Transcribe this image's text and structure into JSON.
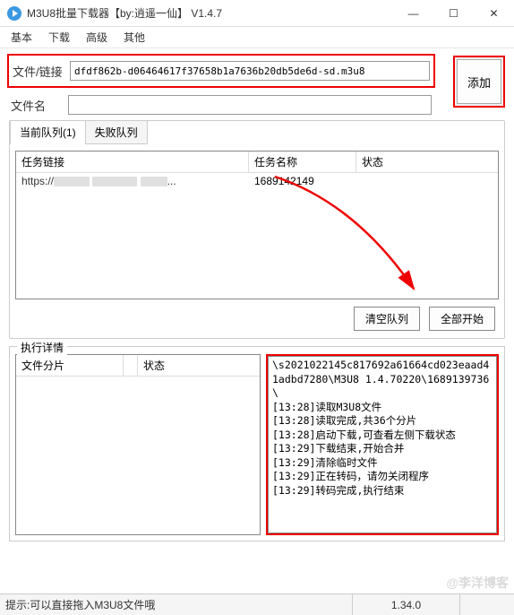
{
  "title": "M3U8批量下载器【by:逍遥一仙】   V1.4.7",
  "menu": [
    "基本",
    "下载",
    "高级",
    "其他"
  ],
  "file_link_label": "文件/链接",
  "file_link_value": "dfdf862b-d06464617f37658b1a7636b20db5de6d-sd.m3u8",
  "filename_label": "文件名",
  "add_button": "添加",
  "tabs": {
    "current": "当前队列(1)",
    "failed": "失败队列"
  },
  "queue_headers": {
    "link": "任务链接",
    "name": "任务名称",
    "status": "状态"
  },
  "queue_row": {
    "link_prefix": "https://",
    "link_suffix": "...",
    "name": "1689142149",
    "status": ""
  },
  "clear_btn": "清空队列",
  "start_btn": "全部开始",
  "exec_legend": "执行详情",
  "exec_headers": {
    "slice": "文件分片",
    "status": "状态"
  },
  "log": "\\s2021022145c817692a61664cd023eaad41adbd7280\\M3U8 1.4.70220\\1689139736\\\n[13:28]读取M3U8文件\n[13:28]读取完成,共36个分片\n[13:28]启动下载,可查看左侧下载状态\n[13:29]下载结束,开始合并\n[13:29]清除临时文件\n[13:29]正在转码，请勿关闭程序\n[13:29]转码完成,执行结束",
  "status_tip": "提示:可以直接拖入M3U8文件哦",
  "status_version": "1.34.0",
  "watermark": "@李洋博客"
}
